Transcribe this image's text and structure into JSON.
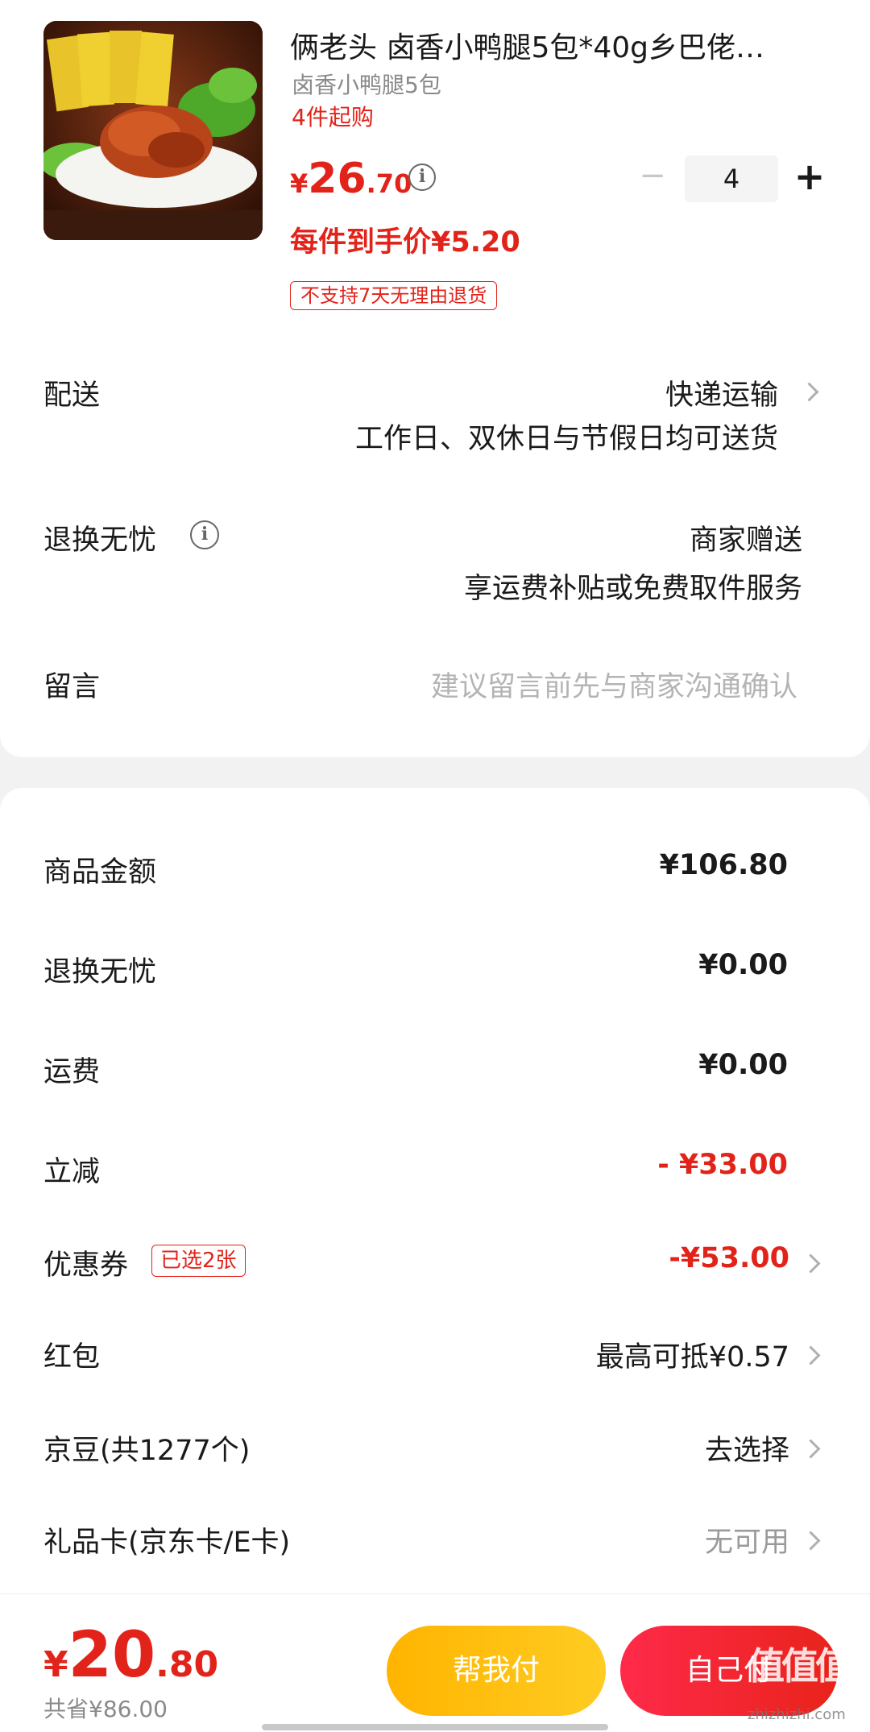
{
  "product": {
    "title": "俩老头 卤香小鸭腿5包*40g乡巴佬…",
    "spec": "卤香小鸭腿5包",
    "moq": "4件起购",
    "price_currency": "¥",
    "price_int": "26",
    "price_dec": ".70",
    "quantity": "4",
    "minus": "−",
    "plus": "+",
    "unit_price": "每件到手价¥5.20",
    "no_return_tag": "不支持7天无理由退货"
  },
  "delivery": {
    "label": "配送",
    "method": "快递运输",
    "note": "工作日、双休日与节假日均可送货"
  },
  "return_worry": {
    "label": "退换无忧",
    "value": "商家赠送",
    "note": "享运费补贴或免费取件服务"
  },
  "message": {
    "label": "留言",
    "placeholder": "建议留言前先与商家沟通确认"
  },
  "summary": {
    "goods_label": "商品金额",
    "goods_value": "¥106.80",
    "return_label": "退换无忧",
    "return_value": "¥0.00",
    "shipping_label": "运费",
    "shipping_value": "¥0.00",
    "discount_label": "立减",
    "discount_value": "- ¥33.00",
    "coupon_label": "优惠券",
    "coupon_badge": "已选2张",
    "coupon_value": "-¥53.00",
    "redpacket_label": "红包",
    "redpacket_value": "最高可抵¥0.57",
    "jingdou_label": "京豆(共1277个)",
    "jingdou_value": "去选择",
    "giftcard_label": "礼品卡(京东卡/E卡)",
    "giftcard_value": "无可用"
  },
  "footer": {
    "total_currency": "¥",
    "total_int": "20",
    "total_dec": ".80",
    "saved": "共省¥86.00",
    "help_pay": "帮我付",
    "self_pay": "自己付",
    "watermark": "值值值",
    "watermark_site": "zhizhizhi.com"
  },
  "colors": {
    "accent_red": "#e2231a",
    "help_button": "#ffb400",
    "text": "#1a1a1a",
    "muted": "#8a8a8a"
  }
}
